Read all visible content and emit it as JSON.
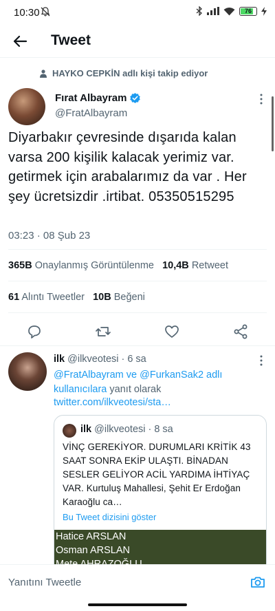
{
  "status_bar": {
    "time": "10:30",
    "battery": "76"
  },
  "header": {
    "title": "Tweet"
  },
  "social_context": "HAYKO CEPKİN adlı kişi takip ediyor",
  "tweet": {
    "author_name": "Fırat Albayram",
    "author_handle": "@FratAlbayram",
    "verified": true,
    "text": "Diyarbakır çevresinde dışarıda kalan varsa 200 kişilik kalacak yerimiz var. getirmek için arabalarımız da var  . Her şey ücretsizdir .irtibat. 05350515295",
    "time": "03:23 · 08 Şub 23",
    "views_count": "365B",
    "views_label": "Onaylanmış Görüntülenme",
    "retweets_count": "10,4B",
    "retweets_label": "Retweet",
    "quotes_count": "61",
    "quotes_label": "Alıntı Tweetler",
    "likes_count": "10B",
    "likes_label": "Beğeni"
  },
  "reply": {
    "name": "ilk",
    "handle": "@ilkveotesi",
    "age": "· 6 sa",
    "replying_mentions": "@FratAlbayram ve @FurkanSak2 adlı kullanıcılara",
    "replying_suffix": "yanıt olarak",
    "link": "twitter.com/ilkveotesi/sta…",
    "quote": {
      "name": "ilk",
      "handle": "@ilkveotesi",
      "age": "· 8 sa",
      "text": "VİNÇ GEREKİYOR. DURUMLARI KRİTİK 43 SAAT SONRA EKİP ULAŞTI. BİNADAN SESLER GELİYOR ACİL YARDIMA İHTİYAÇ VAR. Kurtuluş Mahallesi, Şehit Er Erdoğan Karaoğlu ca…",
      "show_thread": "Bu Tweet dizisini göster",
      "media_names": [
        "Hatice ARSLAN",
        "Osman ARSLAN",
        "Mete AHRAZOĞLU"
      ]
    }
  },
  "compose": {
    "placeholder": "Yanıtını Tweetle"
  },
  "colors": {
    "accent": "#1d9bf0",
    "text": "#0f1419",
    "secondary": "#536471"
  },
  "icons": {
    "back": "arrow-left-icon",
    "verified": "verified-badge-icon",
    "reply": "comment-icon",
    "retweet": "retweet-icon",
    "like": "heart-icon",
    "share": "share-icon",
    "camera": "camera-icon"
  }
}
